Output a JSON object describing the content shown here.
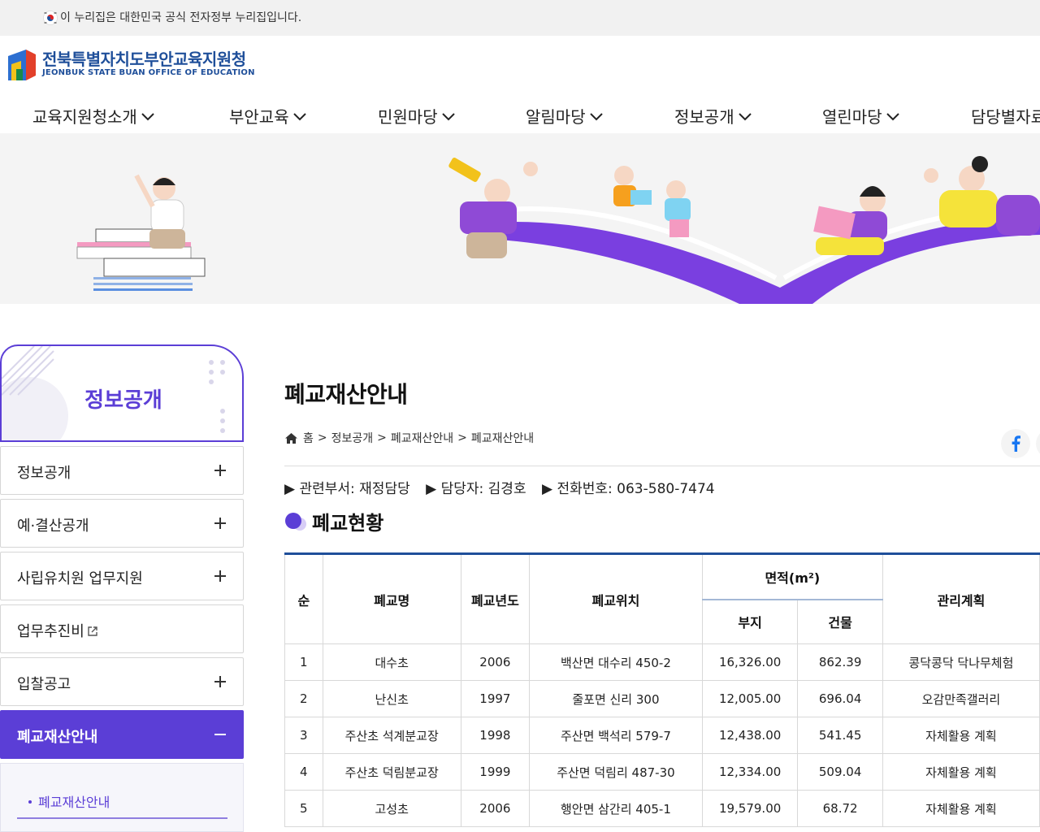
{
  "gov_banner": {
    "text": "이 누리집은 대한민국 공식 전자정부 누리집입니다."
  },
  "logo": {
    "name_ko": "전북특별자치도부안교육지원청",
    "name_en": "JEONBUK STATE BUAN OFFICE OF EDUCATION"
  },
  "gnb": {
    "items": [
      {
        "label": "교육지원청소개"
      },
      {
        "label": "부안교육"
      },
      {
        "label": "민원마당"
      },
      {
        "label": "알림마당"
      },
      {
        "label": "정보공개"
      },
      {
        "label": "열린마당"
      },
      {
        "label": "담당별자료"
      }
    ]
  },
  "lnb": {
    "title": "정보공개",
    "items": [
      {
        "label": "정보공개",
        "type": "expand"
      },
      {
        "label": "예·결산공개",
        "type": "expand"
      },
      {
        "label": "사립유치원 업무지원",
        "type": "expand"
      },
      {
        "label": "업무추진비",
        "type": "external"
      },
      {
        "label": "입찰공고",
        "type": "expand"
      },
      {
        "label": "폐교재산안내",
        "type": "collapse",
        "active": true
      }
    ],
    "sub_items": [
      {
        "label": "폐교재산안내"
      }
    ]
  },
  "page": {
    "title": "폐교재산안내",
    "breadcrumb": [
      "홈",
      "정보공개",
      "폐교재산안내",
      "폐교재산안내"
    ],
    "info": {
      "dept": "▶ 관련부서: 재정담당",
      "manager": "▶ 담당자: 김경호",
      "phone": "▶ 전화번호: 063-580-7474"
    },
    "section_title": "폐교현황"
  },
  "table": {
    "headers": {
      "no": "순",
      "name": "폐교명",
      "year": "폐교년도",
      "location": "폐교위치",
      "area": "면적(m²)",
      "site": "부지",
      "building": "건물",
      "plan": "관리계획"
    },
    "rows": [
      {
        "no": "1",
        "name": "대수초",
        "year": "2006",
        "location": "백산면 대수리 450-2",
        "site": "16,326.00",
        "building": "862.39",
        "plan": "콩닥콩닥 닥나무체험"
      },
      {
        "no": "2",
        "name": "난신초",
        "year": "1997",
        "location": "줄포면 신리 300",
        "site": "12,005.00",
        "building": "696.04",
        "plan": "오감만족갤러리"
      },
      {
        "no": "3",
        "name": "주산초 석계분교장",
        "year": "1998",
        "location": "주산면 백석리 579-7",
        "site": "12,438.00",
        "building": "541.45",
        "plan": "자체활용 계획"
      },
      {
        "no": "4",
        "name": "주산초 덕림분교장",
        "year": "1999",
        "location": "주산면 덕림리 487-30",
        "site": "12,334.00",
        "building": "509.04",
        "plan": "자체활용 계획"
      },
      {
        "no": "5",
        "name": "고성초",
        "year": "2006",
        "location": "행안면 삼간리 405-1",
        "site": "19,579.00",
        "building": "68.72",
        "plan": "자체활용 계획"
      }
    ]
  },
  "colors": {
    "brand_purple": "#5b3ed6",
    "brand_blue": "#1f4f9a",
    "facebook": "#1877f2"
  }
}
